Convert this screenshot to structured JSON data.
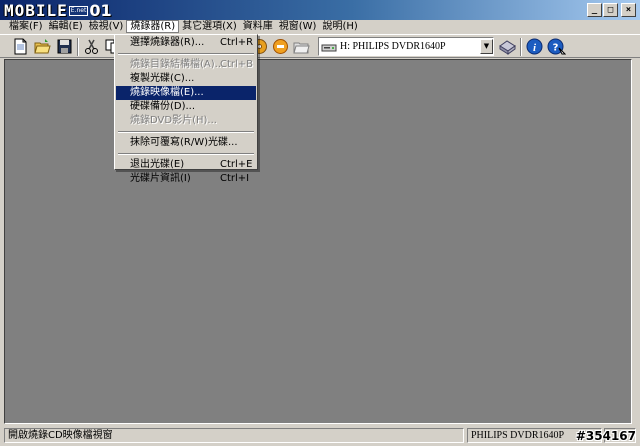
{
  "window": {
    "logo_main": "MOBILE",
    "logo_badge": "E.net",
    "logo_tail": "01",
    "controls": {
      "minimize": "_",
      "maximize": "□",
      "close": "×"
    }
  },
  "menubar": [
    {
      "label": "檔案(F)"
    },
    {
      "label": "編輯(E)"
    },
    {
      "label": "檢視(V)"
    },
    {
      "label": "燒錄器(R)"
    },
    {
      "label": "其它選項(X)"
    },
    {
      "label": "資料庫"
    },
    {
      "label": "視窗(W)"
    },
    {
      "label": "說明(H)"
    }
  ],
  "toolbar": {
    "icons": [
      "new-icon",
      "open-icon",
      "save-icon",
      "cut-icon",
      "copy-icon",
      "burn-icon",
      "stop-icon",
      "folder-icon",
      "drive-icon",
      "info-icon",
      "help-icon"
    ],
    "drive": "H: PHILIPS DVDR1640P"
  },
  "dropdown": {
    "items": [
      {
        "label": "選擇燒錄器(R)...",
        "shortcut": "Ctrl+R",
        "disabled": false
      },
      {
        "label": "燒錄目錄結構檔(A)...",
        "shortcut": "Ctrl+B",
        "disabled": true
      },
      {
        "label": "複製光碟(C)...",
        "shortcut": "",
        "disabled": false
      },
      {
        "label": "燒錄映像檔(E)...",
        "shortcut": "",
        "disabled": false,
        "highlighted": true
      },
      {
        "label": "硬碟備份(D)...",
        "shortcut": "",
        "disabled": false
      },
      {
        "label": "燒錄DVD影片(H)...",
        "shortcut": "",
        "disabled": true
      },
      {
        "label": "抹除可覆寫(R/W)光碟...",
        "shortcut": "",
        "disabled": false
      },
      {
        "label": "退出光碟(E)",
        "shortcut": "Ctrl+E",
        "disabled": false
      },
      {
        "label": "光碟片資訊(I)",
        "shortcut": "Ctrl+I",
        "disabled": false
      }
    ]
  },
  "statusbar": {
    "message": "開啟燒錄CD映像檔視窗",
    "drive": "PHILIPS  DVDR1640P"
  },
  "watermark": "#354167"
}
